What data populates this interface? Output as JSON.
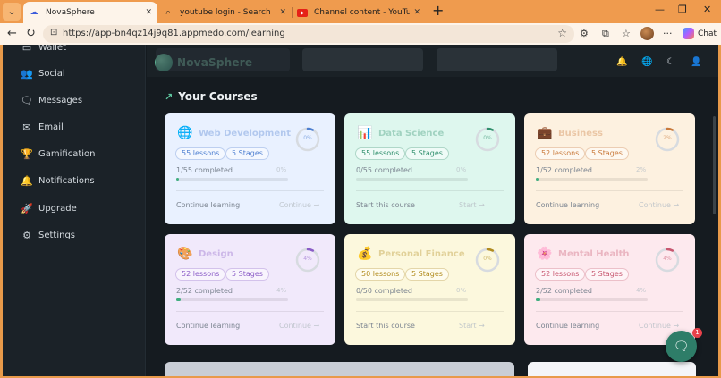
{
  "browser": {
    "tabs": [
      {
        "label": "NovaSphere",
        "favicon": "nova-favicon",
        "active": true
      },
      {
        "label": "youtube login - Search",
        "favicon": "search-icon",
        "active": false
      },
      {
        "label": "Channel content - YouTube Studio",
        "favicon": "youtube-icon",
        "active": false
      }
    ],
    "url": "https://app-bn4qz14j9q81.appmedo.com/learning",
    "copilot_label": "Chat"
  },
  "sidebar": {
    "items": [
      {
        "label": "Wallet",
        "icon": "wallet-icon"
      },
      {
        "label": "Social",
        "icon": "users-icon"
      },
      {
        "label": "Messages",
        "icon": "message-icon"
      },
      {
        "label": "Email",
        "icon": "mail-icon"
      },
      {
        "label": "Gamification",
        "icon": "trophy-icon"
      },
      {
        "label": "Notifications",
        "icon": "bell-icon"
      },
      {
        "label": "Upgrade",
        "icon": "rocket-icon"
      },
      {
        "label": "Settings",
        "icon": "gear-icon"
      }
    ]
  },
  "header": {
    "logo_text": "NovaSphere"
  },
  "section": {
    "title": "Your Courses"
  },
  "courses": [
    {
      "title": "Web Development",
      "icon": "globe-icon",
      "lessons": "55 lessons",
      "stages": "5 Stages",
      "completed": "1/55 completed",
      "percent_label": "0%",
      "progress": 0.02,
      "action": "Continue learning",
      "cta": "Continue",
      "bg": "#e9f1ff",
      "accent": "#4d7fd1"
    },
    {
      "title": "Data Science",
      "icon": "chart-icon",
      "lessons": "55 lessons",
      "stages": "5 Stages",
      "completed": "0/55 completed",
      "percent_label": "0%",
      "progress": 0.0,
      "action": "Start this course",
      "cta": "Start",
      "bg": "#def7ee",
      "accent": "#2f8f6c"
    },
    {
      "title": "Business",
      "icon": "briefcase-icon",
      "lessons": "52 lessons",
      "stages": "5 Stages",
      "completed": "1/52 completed",
      "percent_label": "2%",
      "progress": 0.02,
      "action": "Continue learning",
      "cta": "Continue",
      "bg": "#fdf1e0",
      "accent": "#c9793a"
    },
    {
      "title": "Design",
      "icon": "palette-icon",
      "lessons": "52 lessons",
      "stages": "5 Stages",
      "completed": "2/52 completed",
      "percent_label": "4%",
      "progress": 0.04,
      "action": "Continue learning",
      "cta": "Continue",
      "bg": "#f1e9fb",
      "accent": "#8a5cc7"
    },
    {
      "title": "Personal Finance",
      "icon": "moneybag-icon",
      "lessons": "50 lessons",
      "stages": "5 Stages",
      "completed": "0/50 completed",
      "percent_label": "0%",
      "progress": 0.0,
      "action": "Start this course",
      "cta": "Start",
      "bg": "#fcf8dd",
      "accent": "#b18b1d"
    },
    {
      "title": "Mental Health",
      "icon": "flower-icon",
      "lessons": "52 lessons",
      "stages": "5 Stages",
      "completed": "2/52 completed",
      "percent_label": "4%",
      "progress": 0.04,
      "action": "Continue learning",
      "cta": "Continue",
      "bg": "#fde9ee",
      "accent": "#c8566f"
    }
  ],
  "chat": {
    "badge": "1"
  }
}
